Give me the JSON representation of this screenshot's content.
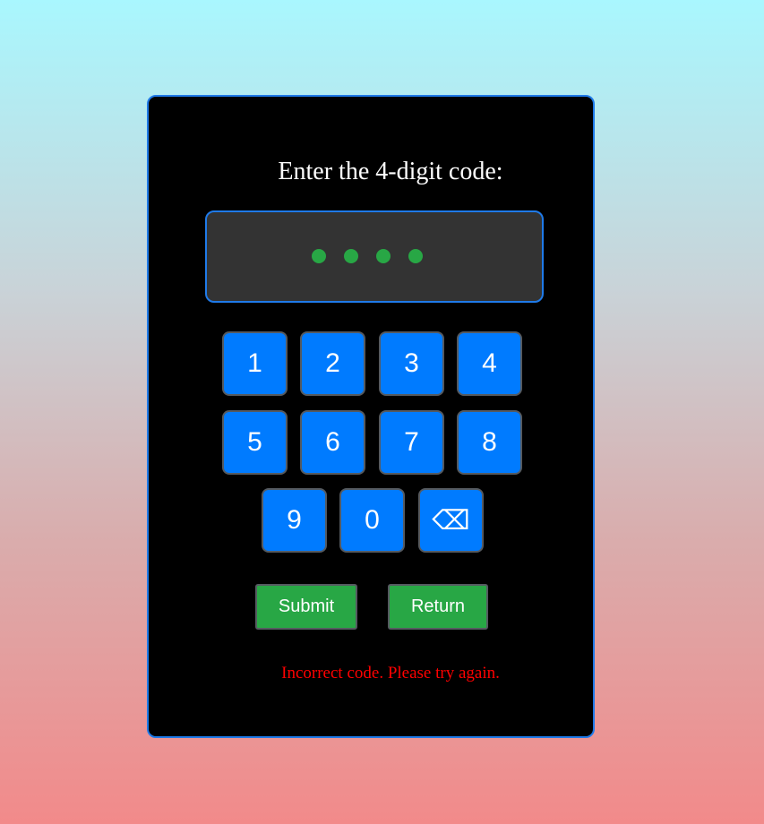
{
  "prompt": "Enter the 4-digit code:",
  "code_display": {
    "filled_digits": 4,
    "dot_color": "#28a745"
  },
  "keypad": {
    "keys": [
      "1",
      "2",
      "3",
      "4",
      "5",
      "6",
      "7",
      "8",
      "9",
      "0"
    ],
    "backspace_label": "⌫"
  },
  "buttons": {
    "submit_label": "Submit",
    "return_label": "Return"
  },
  "error_message": "Incorrect code. Please try again.",
  "colors": {
    "key_blue": "#007bff",
    "action_green": "#28a745",
    "panel_border": "#1f7ae8",
    "error_red": "#ff0000"
  }
}
